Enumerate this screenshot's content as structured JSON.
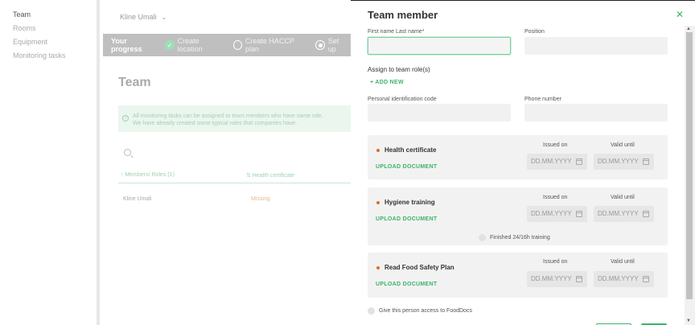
{
  "nav": {
    "items": [
      "Team",
      "Rooms",
      "Equipment",
      "Monitoring tasks"
    ]
  },
  "background": {
    "user": "Kline Umali",
    "progress": {
      "label": "Your progress",
      "steps": [
        "Create location",
        "Create HACCP plan",
        "Set up"
      ]
    },
    "page_title": "Team",
    "info_line1": "All monitoring tasks can be assigned to team members who have same role.",
    "info_line2": "We have already created some typical roles that companies have.",
    "col_members": "↑ Members/ Roles (1)",
    "col_health": "⇅ Health certificate",
    "row_name": "Kline Umali",
    "row_status": "Missing"
  },
  "modal": {
    "title": "Team member",
    "close_icon": "close-icon",
    "first_last_label": "First name Last name*",
    "position_label": "Position",
    "assign_label": "Assign to team role(s)",
    "add_new": "+ ADD NEW",
    "pic_label": "Personal identification code",
    "phone_label": "Phone number",
    "issued_label": "Issued on",
    "valid_label": "Valid until",
    "date_placeholder": "DD.MM.YYYY",
    "upload_label": "UPLOAD DOCUMENT",
    "documents": [
      {
        "title": "Health certificate"
      },
      {
        "title": "Hygiene training",
        "extra": "Finished 24/16h training"
      },
      {
        "title": "Read Food Safety Plan"
      }
    ],
    "access_label": "Give this person access to FoodDocs"
  },
  "colors": {
    "accent": "#3db36b",
    "bullet": "#e06a2c"
  }
}
